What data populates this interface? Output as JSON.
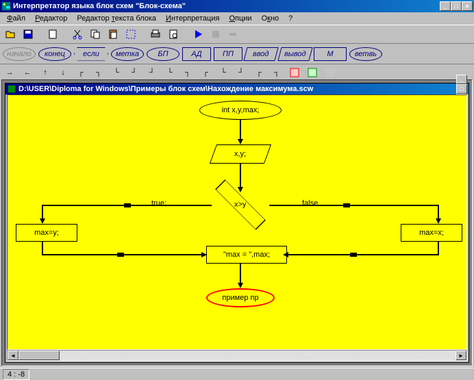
{
  "title": "Интерпретатор языка блок схем \"Блок-схема\"",
  "menu": {
    "file": "Файл",
    "editor": "Редактор",
    "text_editor": "Редактор текста блока",
    "interpret": "Интерпретация",
    "options": "Опции",
    "window": "Окно",
    "help": "?"
  },
  "shapes": {
    "start": "начало",
    "end": "конец",
    "if": "если",
    "label": "метка",
    "bp": "БП",
    "ad": "АД",
    "pp": "ПП",
    "input": "ввод",
    "output": "вывод",
    "m": "М",
    "branch": "ветвь"
  },
  "child": {
    "title": "D:\\USER\\Diploma for Windows\\Примеры блок схем\\Нахождение максимума.scw"
  },
  "nodes": {
    "declare": "int x,y,max;",
    "input": "x,y;",
    "cond": "x>y",
    "true": "true;",
    "false": "false",
    "maxy": "max=y;",
    "maxx": "max=x;",
    "output": "\"max = \",max;",
    "end": "пример пр"
  },
  "status": "4 : -8"
}
